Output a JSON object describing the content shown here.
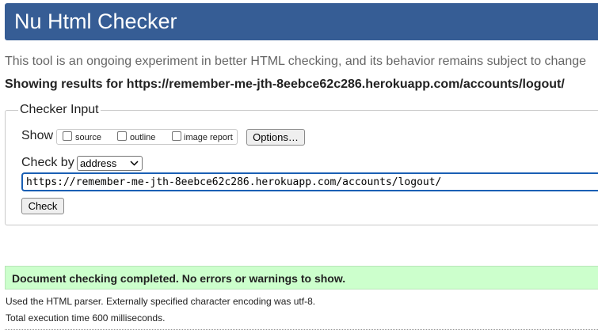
{
  "header": {
    "title": "Nu Html Checker"
  },
  "intro": {
    "text": "This tool is an ongoing experiment in better HTML checking, and its behavior remains subject to change"
  },
  "showing": {
    "text": "Showing results for https://remember-me-jth-8eebce62c286.herokuapp.com/accounts/logout/"
  },
  "checker_input": {
    "legend": "Checker Input",
    "show_label": "Show",
    "options": [
      {
        "label": "source",
        "checked": false
      },
      {
        "label": "outline",
        "checked": false
      },
      {
        "label": "image report",
        "checked": false
      }
    ],
    "options_button": "Options…",
    "check_by_label": "Check by",
    "check_by_value": "address",
    "url_value": "https://remember-me-jth-8eebce62c286.herokuapp.com/accounts/logout/",
    "check_button": "Check"
  },
  "results": {
    "success_message": "Document checking completed. No errors or warnings to show.",
    "parser_info": "Used the HTML parser. Externally specified character encoding was utf-8.",
    "execution_time": "Total execution time 600 milliseconds."
  },
  "colors": {
    "header_bg": "#365d95",
    "success_bg": "#ccffcc",
    "focus_outline": "#1a5fb4"
  }
}
